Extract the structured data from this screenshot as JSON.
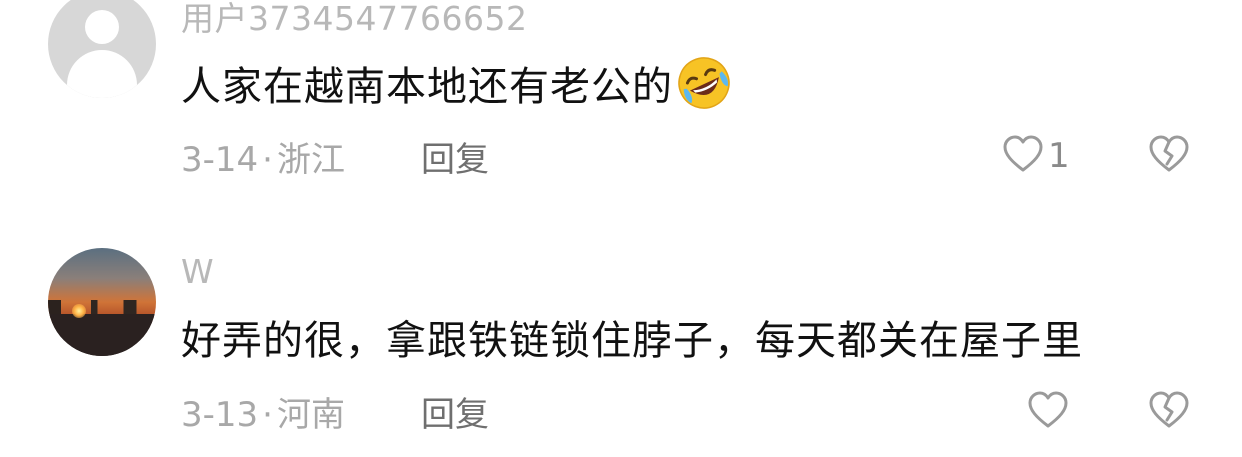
{
  "comments": [
    {
      "username": "用户3734547766652",
      "text": "人家在越南本地还有老公的",
      "emoji_icon": "rolling-on-floor-laughing-icon",
      "date": "3-14",
      "separator": "·",
      "location": "浙江",
      "reply_label": "回复",
      "like_count": "1",
      "avatar": "default-avatar-icon"
    },
    {
      "username": "W",
      "text": "好弄的很，拿跟铁链锁住脖子，每天都关在屋子里",
      "date": "3-13",
      "separator": "·",
      "location": "河南",
      "reply_label": "回复",
      "like_count": "",
      "avatar": "sunset-photo"
    }
  ],
  "colors": {
    "username": "#b8b8b8",
    "text": "#111111",
    "meta": "#a8a8a8",
    "reply": "#6f6f6f",
    "icon": "#9a9a9a"
  }
}
